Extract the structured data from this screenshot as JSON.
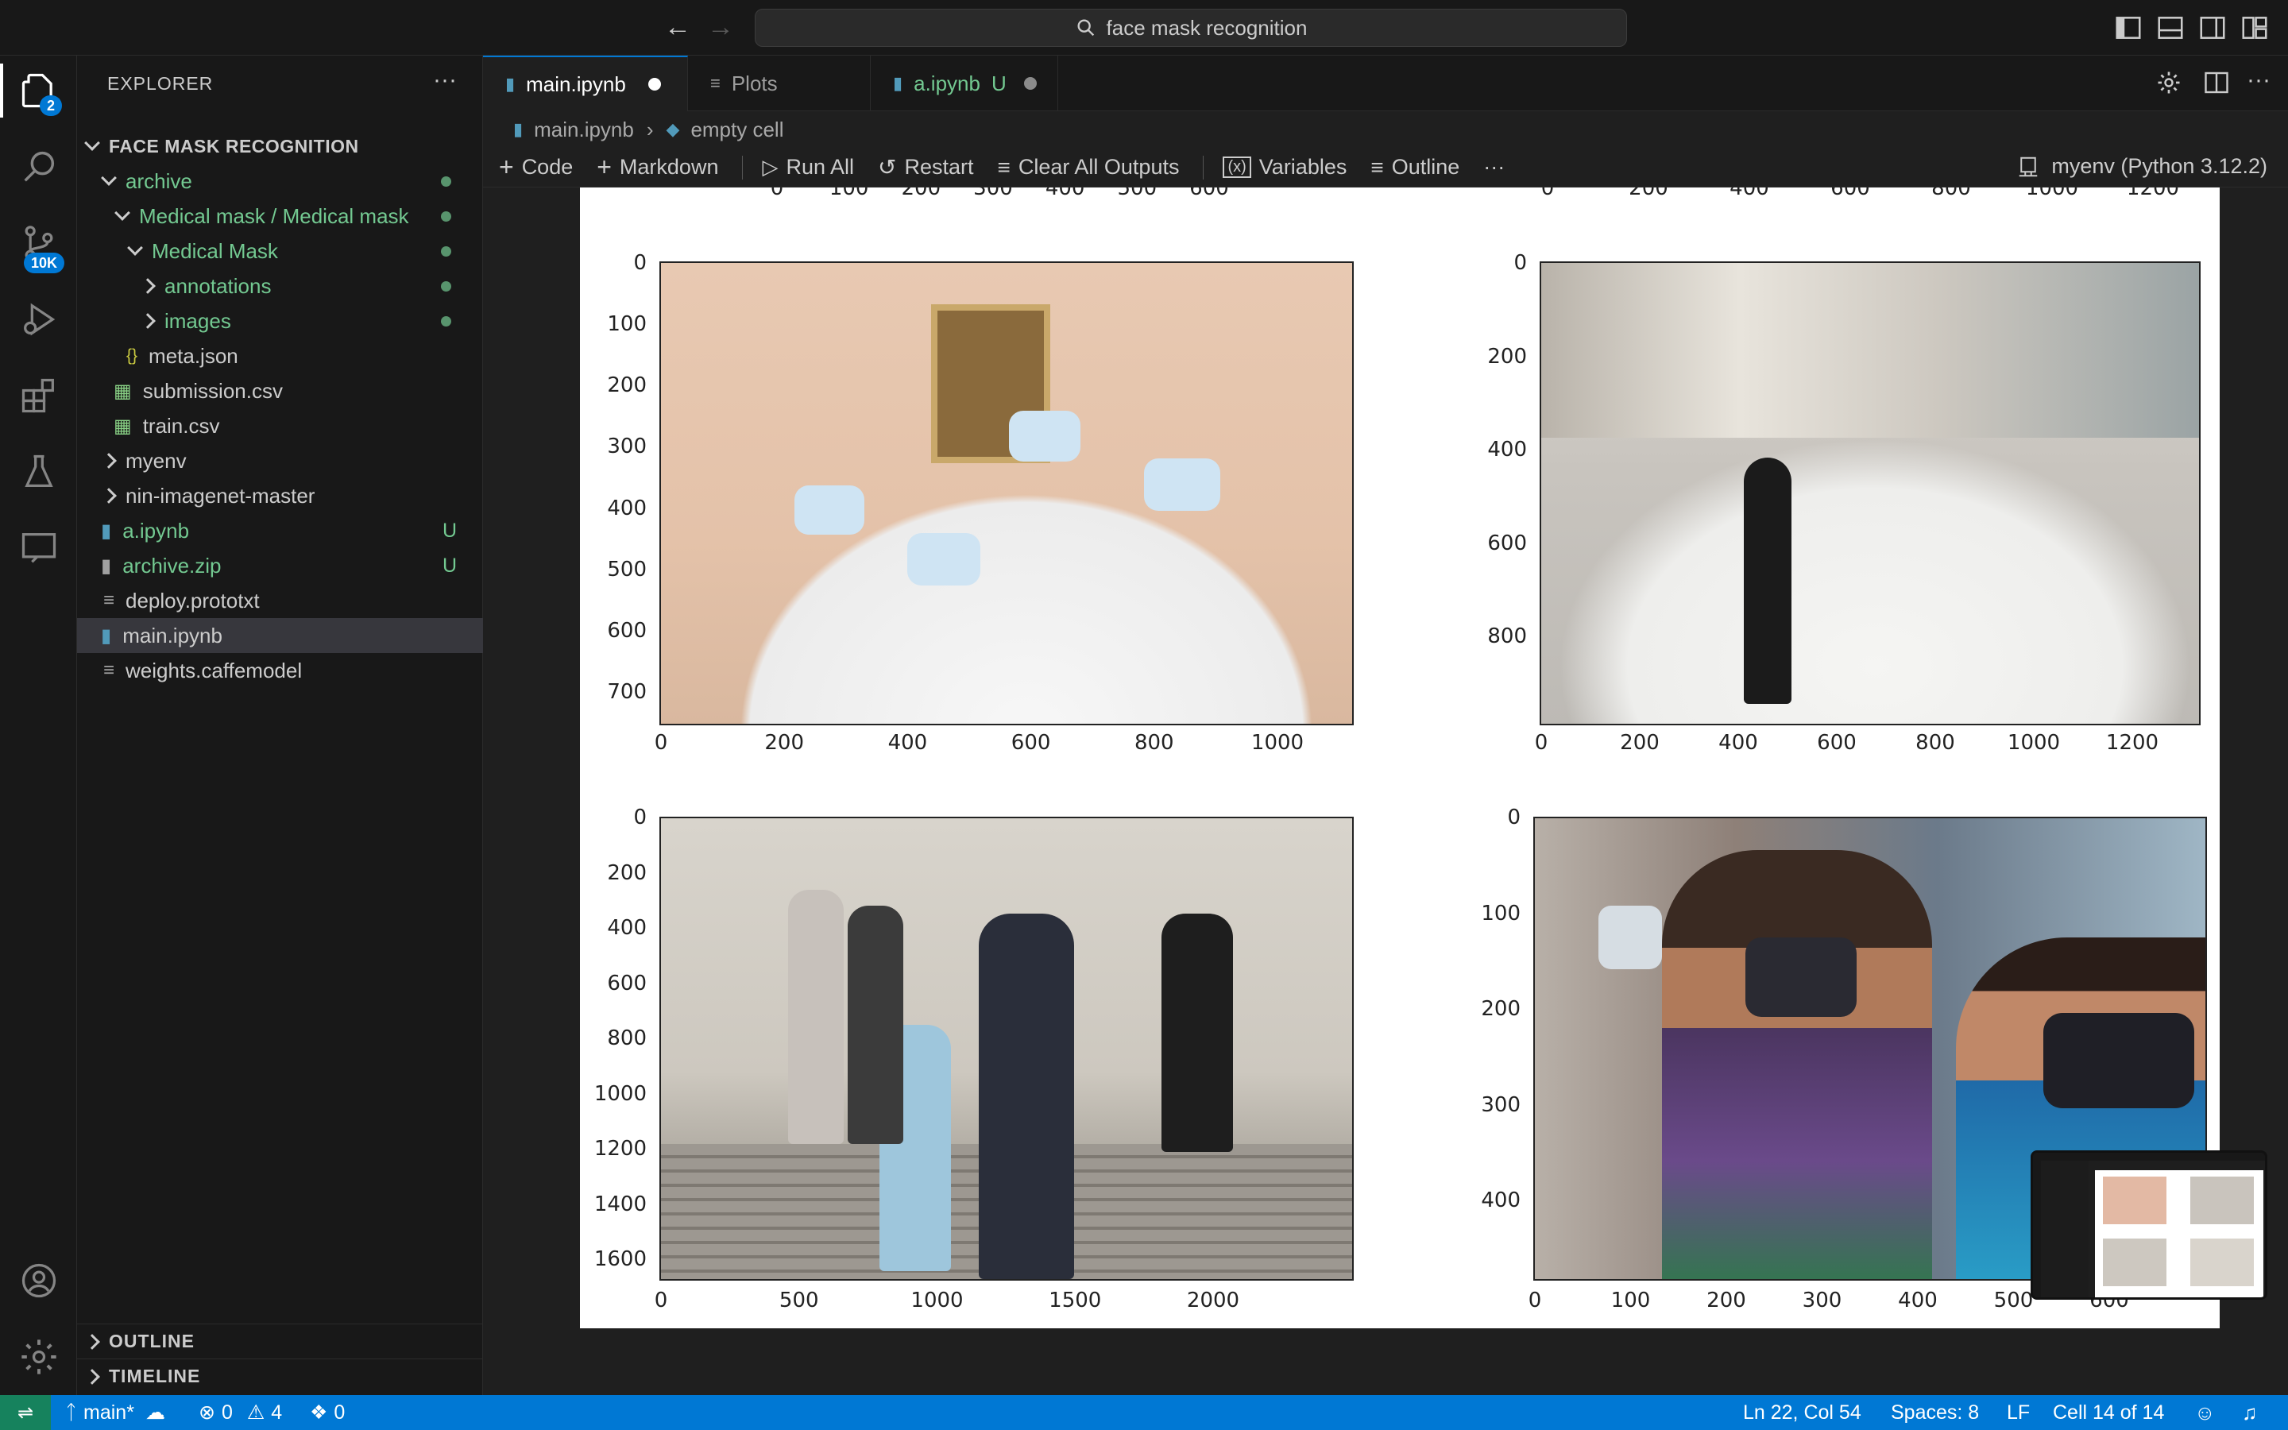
{
  "titlebar": {
    "search_text": "face mask recognition"
  },
  "activity": {
    "explorer_badge": "2",
    "scm_badge": "10K"
  },
  "sidebar": {
    "title": "EXPLORER",
    "root": "FACE MASK RECOGNITION",
    "items": [
      {
        "label": "archive"
      },
      {
        "label": "Medical mask / Medical mask"
      },
      {
        "label": "Medical Mask"
      },
      {
        "label": "annotations"
      },
      {
        "label": "images"
      },
      {
        "label": "meta.json"
      },
      {
        "label": "submission.csv"
      },
      {
        "label": "train.csv"
      },
      {
        "label": "myenv"
      },
      {
        "label": "nin-imagenet-master"
      },
      {
        "label": "a.ipynb",
        "status": "U"
      },
      {
        "label": "archive.zip",
        "status": "U"
      },
      {
        "label": "deploy.prototxt"
      },
      {
        "label": "main.ipynb"
      },
      {
        "label": "weights.caffemodel"
      }
    ],
    "outline": "OUTLINE",
    "timeline": "TIMELINE"
  },
  "tabs": [
    {
      "label": "main.ipynb"
    },
    {
      "label": "Plots"
    },
    {
      "label": "a.ipynb",
      "status": "U"
    }
  ],
  "breadcrumb": {
    "file": "main.ipynb",
    "cell": "empty cell"
  },
  "toolbar": {
    "code": "Code",
    "markdown": "Markdown",
    "run_all": "Run All",
    "restart": "Restart",
    "clear": "Clear All Outputs",
    "variables": "Variables",
    "outline": "Outline",
    "more": "···",
    "kernel": "myenv (Python 3.12.2)"
  },
  "plots": {
    "top_partial_left_ticks": [
      "0",
      "100",
      "200",
      "300",
      "400",
      "500",
      "600"
    ],
    "top_partial_right_ticks": [
      "0",
      "200",
      "400",
      "600",
      "800",
      "1000",
      "1200"
    ],
    "p1": {
      "y": [
        "0",
        "100",
        "200",
        "300",
        "400",
        "500",
        "600",
        "700"
      ],
      "x": [
        "0",
        "200",
        "400",
        "600",
        "800",
        "1000"
      ]
    },
    "p2": {
      "y": [
        "0",
        "200",
        "400",
        "600",
        "800"
      ],
      "x": [
        "0",
        "200",
        "400",
        "600",
        "800",
        "1000",
        "1200"
      ]
    },
    "p3": {
      "y": [
        "0",
        "200",
        "400",
        "600",
        "800",
        "1000",
        "1200",
        "1400",
        "1600"
      ],
      "x": [
        "0",
        "500",
        "1000",
        "1500",
        "2000"
      ]
    },
    "p4": {
      "y": [
        "0",
        "100",
        "200",
        "300",
        "400"
      ],
      "x": [
        "0",
        "100",
        "200",
        "300",
        "400",
        "500",
        "600"
      ]
    }
  },
  "status": {
    "branch": "main*",
    "errors": "0",
    "warnings": "4",
    "ports": "0",
    "position": "Ln 22, Col 54",
    "spaces": "Spaces: 8",
    "eol": "LF",
    "cell": "Cell 14 of 14"
  },
  "colors": {
    "accent": "#0078d4",
    "git_green": "#73c991"
  }
}
